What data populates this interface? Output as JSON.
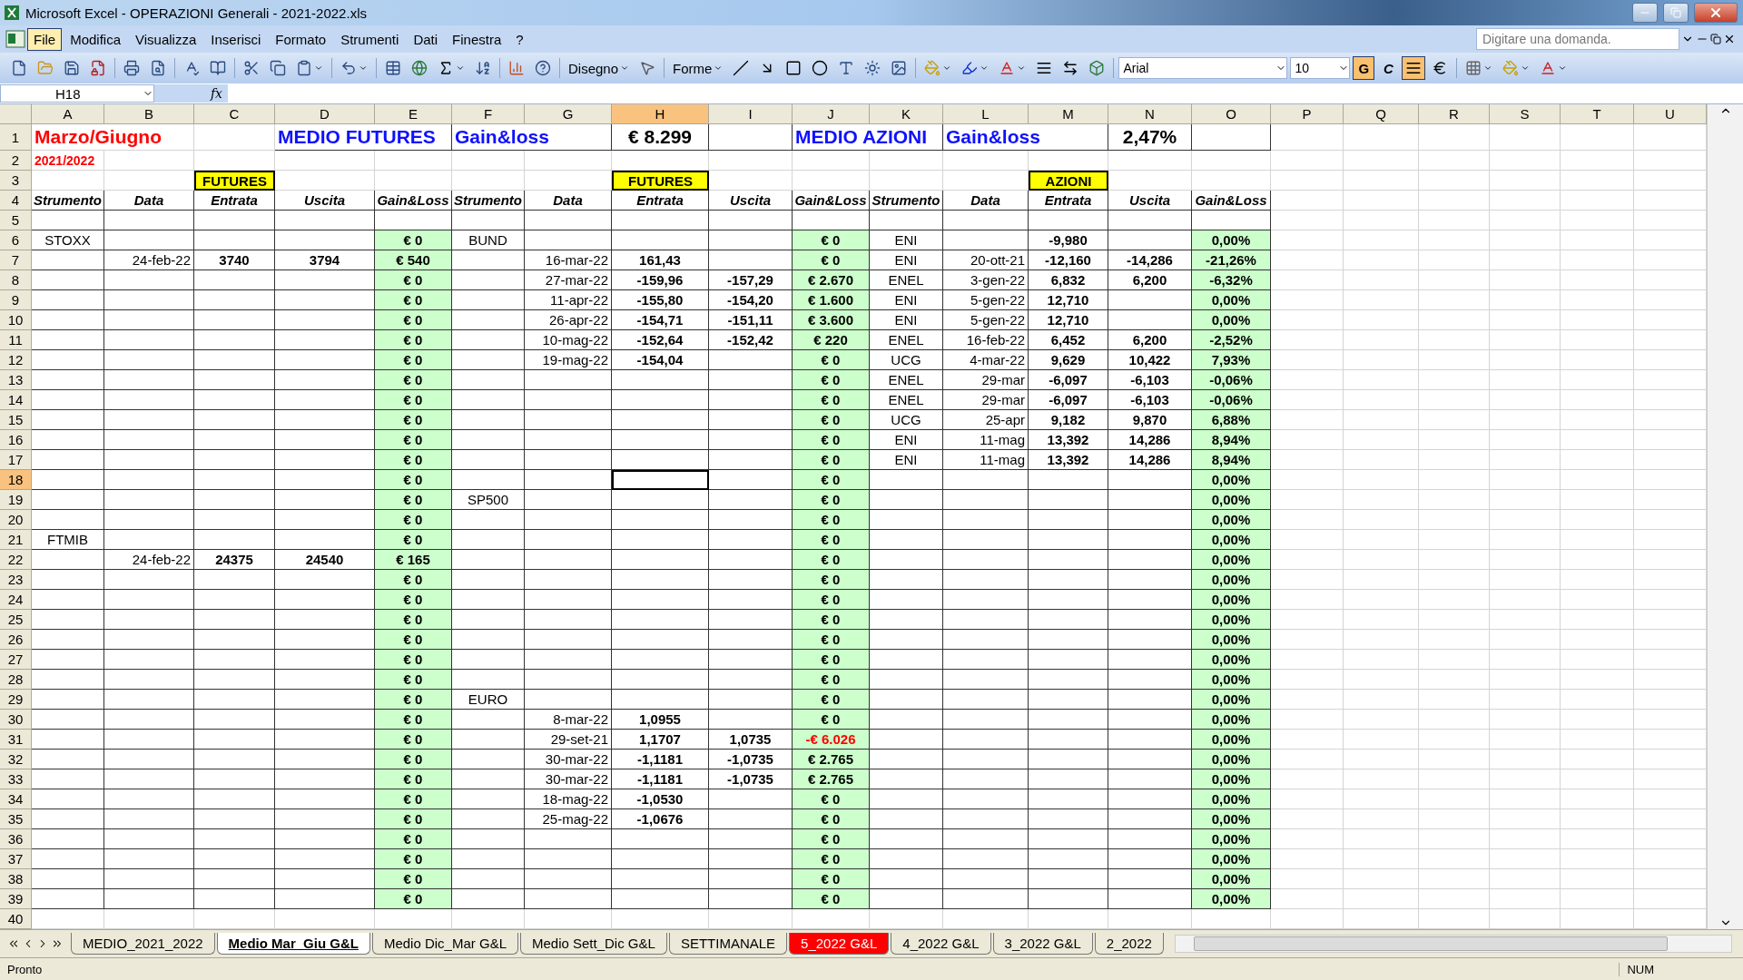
{
  "window": {
    "title": "Microsoft Excel - OPERAZIONI Generali - 2021-2022.xls"
  },
  "menu": [
    {
      "label": "File",
      "selected": true
    },
    {
      "label": "Modifica",
      "selected": false
    },
    {
      "label": "Visualizza",
      "selected": false
    },
    {
      "label": "Inserisci",
      "selected": false
    },
    {
      "label": "Formato",
      "selected": false
    },
    {
      "label": "Strumenti",
      "selected": false
    },
    {
      "label": "Dati",
      "selected": false
    },
    {
      "label": "Finestra",
      "selected": false
    },
    {
      "label": "?",
      "selected": false
    }
  ],
  "help": {
    "placeholder": "Digitare una domanda."
  },
  "toolbar": {
    "draw_label": "Disegno",
    "shapes_label": "Forme",
    "font": "Arial",
    "size": "10",
    "bold": true,
    "italic": false,
    "center": true,
    "bold_label": "G",
    "italic_label": "C"
  },
  "formula_bar": {
    "name_box": "H18",
    "function_label": "fx"
  },
  "columns": [
    {
      "label": "A",
      "selected": false
    },
    {
      "label": "B",
      "selected": false
    },
    {
      "label": "C",
      "selected": false
    },
    {
      "label": "D",
      "selected": false
    },
    {
      "label": "E",
      "selected": false
    },
    {
      "label": "F",
      "selected": false
    },
    {
      "label": "G",
      "selected": false
    },
    {
      "label": "H",
      "selected": true
    },
    {
      "label": "I",
      "selected": false
    },
    {
      "label": "J",
      "selected": false
    },
    {
      "label": "K",
      "selected": false
    },
    {
      "label": "L",
      "selected": false
    },
    {
      "label": "M",
      "selected": false
    },
    {
      "label": "N",
      "selected": false
    },
    {
      "label": "O",
      "selected": false
    },
    {
      "label": "P",
      "selected": false
    },
    {
      "label": "Q",
      "selected": false
    },
    {
      "label": "R",
      "selected": false
    },
    {
      "label": "S",
      "selected": false
    },
    {
      "label": "T",
      "selected": false
    },
    {
      "label": "U",
      "selected": false
    }
  ],
  "rows": [
    {
      "n": "1",
      "selected": false,
      "cells": [
        "Marzo/Giugno",
        null,
        null,
        "MEDIO FUTURES",
        null,
        "Gain&loss",
        null,
        "€ 8.299",
        null,
        "MEDIO AZIONI",
        null,
        "Gain&loss",
        null,
        "2,47%",
        null
      ]
    },
    {
      "n": "2",
      "selected": false,
      "cells": [
        "2021/2022",
        null,
        null,
        null,
        null,
        null,
        null,
        null,
        null,
        null,
        null,
        null,
        null,
        null,
        null
      ]
    },
    {
      "n": "3",
      "selected": false,
      "cells": [
        null,
        null,
        "FUTURES",
        null,
        null,
        null,
        null,
        "FUTURES",
        null,
        null,
        null,
        null,
        "AZIONI",
        null,
        null
      ]
    },
    {
      "n": "4",
      "selected": false,
      "cells": [
        "Strumento",
        "Data",
        "Entrata",
        "Uscita",
        "Gain&Loss",
        "Strumento",
        "Data",
        "Entrata",
        "Uscita",
        "Gain&Loss",
        "Strumento",
        "Data",
        "Entrata",
        "Uscita",
        "Gain&Loss"
      ]
    },
    {
      "n": "5",
      "selected": false,
      "cells": [
        null,
        null,
        null,
        null,
        null,
        null,
        null,
        null,
        null,
        null,
        null,
        null,
        null,
        null,
        null
      ]
    },
    {
      "n": "6",
      "selected": false,
      "cells": [
        "STOXX",
        null,
        null,
        null,
        "€ 0",
        "BUND",
        null,
        null,
        null,
        "€ 0",
        "ENI",
        null,
        "-9,980",
        null,
        "0,00%"
      ]
    },
    {
      "n": "7",
      "selected": false,
      "cells": [
        null,
        "24-feb-22",
        "3740",
        "3794",
        "€ 540",
        null,
        "16-mar-22",
        "161,43",
        null,
        "€ 0",
        "ENI",
        "20-ott-21",
        "-12,160",
        "-14,286",
        "-21,26%"
      ]
    },
    {
      "n": "8",
      "selected": false,
      "cells": [
        null,
        null,
        null,
        null,
        "€ 0",
        null,
        "27-mar-22",
        "-159,96",
        "-157,29",
        "€ 2.670",
        "ENEL",
        "3-gen-22",
        "6,832",
        "6,200",
        "-6,32%"
      ]
    },
    {
      "n": "9",
      "selected": false,
      "cells": [
        null,
        null,
        null,
        null,
        "€ 0",
        null,
        "11-apr-22",
        "-155,80",
        "-154,20",
        "€ 1.600",
        "ENI",
        "5-gen-22",
        "12,710",
        null,
        "0,00%"
      ]
    },
    {
      "n": "10",
      "selected": false,
      "cells": [
        null,
        null,
        null,
        null,
        "€ 0",
        null,
        "26-apr-22",
        "-154,71",
        "-151,11",
        "€ 3.600",
        "ENI",
        "5-gen-22",
        "12,710",
        null,
        "0,00%"
      ]
    },
    {
      "n": "11",
      "selected": false,
      "cells": [
        null,
        null,
        null,
        null,
        "€ 0",
        null,
        "10-mag-22",
        "-152,64",
        "-152,42",
        "€ 220",
        "ENEL",
        "16-feb-22",
        "6,452",
        "6,200",
        "-2,52%"
      ]
    },
    {
      "n": "12",
      "selected": false,
      "cells": [
        null,
        null,
        null,
        null,
        "€ 0",
        null,
        "19-mag-22",
        "-154,04",
        null,
        "€ 0",
        "UCG",
        "4-mar-22",
        "9,629",
        "10,422",
        "7,93%"
      ]
    },
    {
      "n": "13",
      "selected": false,
      "cells": [
        null,
        null,
        null,
        null,
        "€ 0",
        null,
        null,
        null,
        null,
        "€ 0",
        "ENEL",
        "29-mar",
        "-6,097",
        "-6,103",
        "-0,06%"
      ]
    },
    {
      "n": "14",
      "selected": false,
      "cells": [
        null,
        null,
        null,
        null,
        "€ 0",
        null,
        null,
        null,
        null,
        "€ 0",
        "ENEL",
        "29-mar",
        "-6,097",
        "-6,103",
        "-0,06%"
      ]
    },
    {
      "n": "15",
      "selected": false,
      "cells": [
        null,
        null,
        null,
        null,
        "€ 0",
        null,
        null,
        null,
        null,
        "€ 0",
        "UCG",
        "25-apr",
        "9,182",
        "9,870",
        "6,88%"
      ]
    },
    {
      "n": "16",
      "selected": false,
      "cells": [
        null,
        null,
        null,
        null,
        "€ 0",
        null,
        null,
        null,
        null,
        "€ 0",
        "ENI",
        "11-mag",
        "13,392",
        "14,286",
        "8,94%"
      ]
    },
    {
      "n": "17",
      "selected": false,
      "cells": [
        null,
        null,
        null,
        null,
        "€ 0",
        null,
        null,
        null,
        null,
        "€ 0",
        "ENI",
        "11-mag",
        "13,392",
        "14,286",
        "8,94%"
      ]
    },
    {
      "n": "18",
      "selected": true,
      "cells": [
        null,
        null,
        null,
        null,
        "€ 0",
        null,
        null,
        null,
        null,
        "€ 0",
        null,
        null,
        null,
        null,
        "0,00%"
      ]
    },
    {
      "n": "19",
      "selected": false,
      "cells": [
        null,
        null,
        null,
        null,
        "€ 0",
        "SP500",
        null,
        null,
        null,
        "€ 0",
        null,
        null,
        null,
        null,
        "0,00%"
      ]
    },
    {
      "n": "20",
      "selected": false,
      "cells": [
        null,
        null,
        null,
        null,
        "€ 0",
        null,
        null,
        null,
        null,
        "€ 0",
        null,
        null,
        null,
        null,
        "0,00%"
      ]
    },
    {
      "n": "21",
      "selected": false,
      "cells": [
        "FTMIB",
        null,
        null,
        null,
        "€ 0",
        null,
        null,
        null,
        null,
        "€ 0",
        null,
        null,
        null,
        null,
        "0,00%"
      ]
    },
    {
      "n": "22",
      "selected": false,
      "cells": [
        null,
        "24-feb-22",
        "24375",
        "24540",
        "€ 165",
        null,
        null,
        null,
        null,
        "€ 0",
        null,
        null,
        null,
        null,
        "0,00%"
      ]
    },
    {
      "n": "23",
      "selected": false,
      "cells": [
        null,
        null,
        null,
        null,
        "€ 0",
        null,
        null,
        null,
        null,
        "€ 0",
        null,
        null,
        null,
        null,
        "0,00%"
      ]
    },
    {
      "n": "24",
      "selected": false,
      "cells": [
        null,
        null,
        null,
        null,
        "€ 0",
        null,
        null,
        null,
        null,
        "€ 0",
        null,
        null,
        null,
        null,
        "0,00%"
      ]
    },
    {
      "n": "25",
      "selected": false,
      "cells": [
        null,
        null,
        null,
        null,
        "€ 0",
        null,
        null,
        null,
        null,
        "€ 0",
        null,
        null,
        null,
        null,
        "0,00%"
      ]
    },
    {
      "n": "26",
      "selected": false,
      "cells": [
        null,
        null,
        null,
        null,
        "€ 0",
        null,
        null,
        null,
        null,
        "€ 0",
        null,
        null,
        null,
        null,
        "0,00%"
      ]
    },
    {
      "n": "27",
      "selected": false,
      "cells": [
        null,
        null,
        null,
        null,
        "€ 0",
        null,
        null,
        null,
        null,
        "€ 0",
        null,
        null,
        null,
        null,
        "0,00%"
      ]
    },
    {
      "n": "28",
      "selected": false,
      "cells": [
        null,
        null,
        null,
        null,
        "€ 0",
        null,
        null,
        null,
        null,
        "€ 0",
        null,
        null,
        null,
        null,
        "0,00%"
      ]
    },
    {
      "n": "29",
      "selected": false,
      "cells": [
        null,
        null,
        null,
        null,
        "€ 0",
        "EURO",
        null,
        null,
        null,
        "€ 0",
        null,
        null,
        null,
        null,
        "0,00%"
      ]
    },
    {
      "n": "30",
      "selected": false,
      "cells": [
        null,
        null,
        null,
        null,
        "€ 0",
        null,
        "8-mar-22",
        "1,0955",
        null,
        "€ 0",
        null,
        null,
        null,
        null,
        "0,00%"
      ]
    },
    {
      "n": "31",
      "selected": false,
      "cells": [
        null,
        null,
        null,
        null,
        "€ 0",
        null,
        "29-set-21",
        "1,1707",
        "1,0735",
        {
          "text": "-€ 6.026",
          "negative": true
        },
        null,
        null,
        null,
        null,
        "0,00%"
      ]
    },
    {
      "n": "32",
      "selected": false,
      "cells": [
        null,
        null,
        null,
        null,
        "€ 0",
        null,
        "30-mar-22",
        "-1,1181",
        "-1,0735",
        "€ 2.765",
        null,
        null,
        null,
        null,
        "0,00%"
      ]
    },
    {
      "n": "33",
      "selected": false,
      "cells": [
        null,
        null,
        null,
        null,
        "€ 0",
        null,
        "30-mar-22",
        "-1,1181",
        "-1,0735",
        "€ 2.765",
        null,
        null,
        null,
        null,
        "0,00%"
      ]
    },
    {
      "n": "34",
      "selected": false,
      "cells": [
        null,
        null,
        null,
        null,
        "€ 0",
        null,
        "18-mag-22",
        "-1,0530",
        null,
        "€ 0",
        null,
        null,
        null,
        null,
        "0,00%"
      ]
    },
    {
      "n": "35",
      "selected": false,
      "cells": [
        null,
        null,
        null,
        null,
        "€ 0",
        null,
        "25-mag-22",
        "-1,0676",
        null,
        "€ 0",
        null,
        null,
        null,
        null,
        "0,00%"
      ]
    },
    {
      "n": "36",
      "selected": false,
      "cells": [
        null,
        null,
        null,
        null,
        "€ 0",
        null,
        null,
        null,
        null,
        "€ 0",
        null,
        null,
        null,
        null,
        "0,00%"
      ]
    },
    {
      "n": "37",
      "selected": false,
      "cells": [
        null,
        null,
        null,
        null,
        "€ 0",
        null,
        null,
        null,
        null,
        "€ 0",
        null,
        null,
        null,
        null,
        "0,00%"
      ]
    },
    {
      "n": "38",
      "selected": false,
      "cells": [
        null,
        null,
        null,
        null,
        "€ 0",
        null,
        null,
        null,
        null,
        "€ 0",
        null,
        null,
        null,
        null,
        "0,00%"
      ]
    },
    {
      "n": "39",
      "selected": false,
      "cells": [
        null,
        null,
        null,
        null,
        "€ 0",
        null,
        null,
        null,
        null,
        "€ 0",
        null,
        null,
        null,
        null,
        "0,00%"
      ]
    },
    {
      "n": "40",
      "selected": false,
      "cells": [
        null,
        null,
        null,
        null,
        null,
        null,
        null,
        null,
        null,
        null,
        null,
        null,
        null,
        null,
        null
      ]
    }
  ],
  "sheet_tabs": [
    {
      "label": "MEDIO_2021_2022",
      "selected": false
    },
    {
      "label": "Medio Mar_Giu G&L",
      "selected": true
    },
    {
      "label": "Medio Dic_Mar G&L",
      "selected": false
    },
    {
      "label": "Medio Sett_Dic G&L",
      "selected": false
    },
    {
      "label": "SETTIMANALE",
      "selected": false
    },
    {
      "label": "5_2022 G&L",
      "selected": false,
      "color": "#ff0000"
    },
    {
      "label": "4_2022 G&L",
      "selected": false
    },
    {
      "label": "3_2022 G&L",
      "selected": false
    },
    {
      "label": "2_2022",
      "selected": false
    }
  ],
  "status_bar": {
    "state": "Pronto",
    "num": "NUM"
  }
}
